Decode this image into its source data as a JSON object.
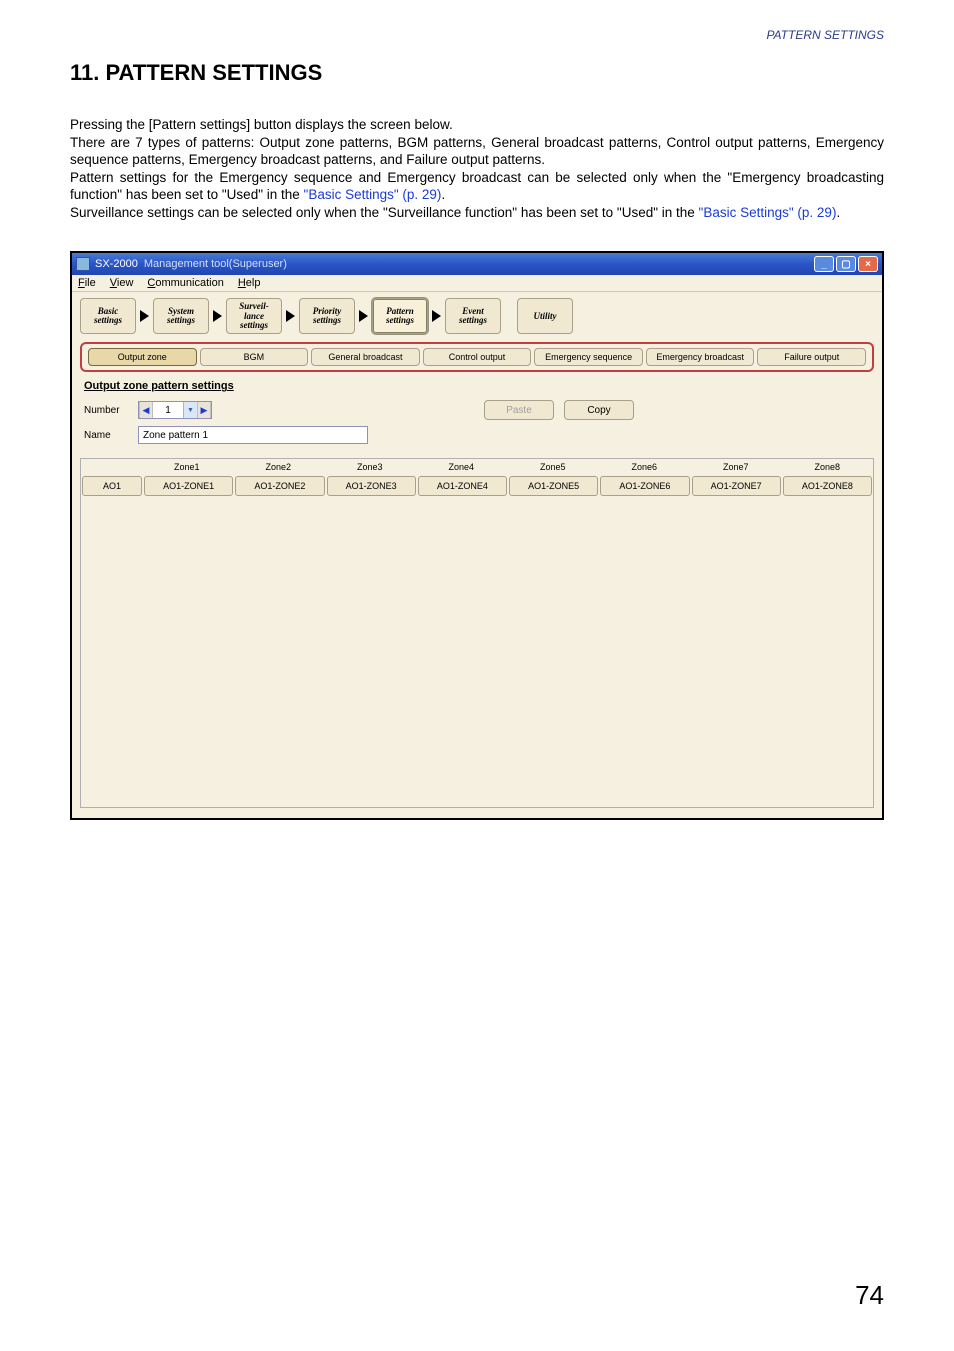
{
  "header": {
    "running": "PATTERN SETTINGS"
  },
  "section": {
    "number": "11.",
    "title": "PATTERN SETTINGS"
  },
  "para": {
    "p1": "Pressing the [Pattern settings] button displays the screen below.",
    "p2": "There are 7 types of patterns: Output zone patterns, BGM patterns, General broadcast patterns, Control output patterns, Emergency sequence patterns, Emergency broadcast patterns, and Failure output patterns.",
    "p3a": "Pattern settings for the Emergency sequence and Emergency broadcast can be selected only when the \"Emergency broadcasting function\" has been set to \"Used\" in the ",
    "p3link": "\"Basic Settings\" (p. 29)",
    "p3b": ".",
    "p4a": "Surveillance settings can be selected only when the \"Surveillance function\" has been set to \"Used\" in the ",
    "p4link": "\"Basic Settings\" (p. 29)",
    "p4b": "."
  },
  "titlebar": {
    "product": "SX-2000",
    "name": "Management tool(Superuser)"
  },
  "menu": {
    "file": "File",
    "view": "View",
    "comm": "Communication",
    "help": "Help"
  },
  "wizard": {
    "basic": "Basic settings",
    "system": "System settings",
    "surveil": "Surveil-\nlance settings",
    "priority": "Priority settings",
    "pattern": "Pattern settings",
    "event": "Event settings",
    "utility": "Utility"
  },
  "tabs": {
    "output": "Output zone",
    "bgm": "BGM",
    "general": "General broadcast",
    "control": "Control output",
    "eseq": "Emergency sequence",
    "ebcast": "Emergency broadcast",
    "failure": "Failure output"
  },
  "panel": {
    "heading": "Output zone pattern settings",
    "numberLabel": "Number",
    "numberValue": "1",
    "nameLabel": "Name",
    "nameValue": "Zone pattern 1",
    "paste": "Paste",
    "copy": "Copy"
  },
  "zones": {
    "rowLabel": "AO1",
    "headers": [
      "Zone1",
      "Zone2",
      "Zone3",
      "Zone4",
      "Zone5",
      "Zone6",
      "Zone7",
      "Zone8"
    ],
    "cells": [
      "AO1-ZONE1",
      "AO1-ZONE2",
      "AO1-ZONE3",
      "AO1-ZONE4",
      "AO1-ZONE5",
      "AO1-ZONE6",
      "AO1-ZONE7",
      "AO1-ZONE8"
    ]
  },
  "pageNumber": "74"
}
